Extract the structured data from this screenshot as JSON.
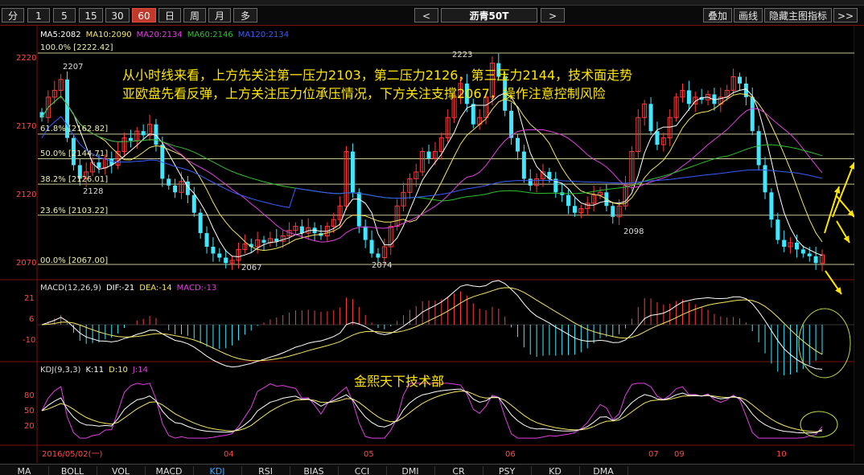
{
  "toolbar": {
    "periods": [
      "分",
      "1",
      "5",
      "15",
      "30",
      "60",
      "日",
      "周",
      "月",
      "多"
    ],
    "active_period": "60",
    "prev": "<",
    "instrument": "沥青50T",
    "next": ">",
    "overlay": "叠加",
    "draw": "画线",
    "hide_indicator": "隐藏主图指标",
    "more": ">>"
  },
  "main_panel": {
    "ma_legend": [
      {
        "text": "MA5:2082",
        "color": "#ffffff"
      },
      {
        "text": "MA10:2090",
        "color": "#f5e663"
      },
      {
        "text": "MA20:2134",
        "color": "#e040e0"
      },
      {
        "text": "MA60:2146",
        "color": "#2fbf2f"
      },
      {
        "text": "MA120:2134",
        "color": "#3a5cff"
      }
    ],
    "y_ticks": [
      "2220",
      "2170",
      "2120",
      "2070"
    ],
    "fib_levels": [
      {
        "label": "100.0% [2222.42]",
        "value": 2222.42
      },
      {
        "label": "61.8% [2162.82]",
        "value": 2162.82
      },
      {
        "label": "50.0% [2144.71]",
        "value": 2144.71
      },
      {
        "label": "38.2% [2126.01]",
        "value": 2126.01
      },
      {
        "label": "23.6% [2103.22]",
        "value": 2103.22
      },
      {
        "label": "00.0% [2067.00]",
        "value": 2067.0
      }
    ],
    "price_marks": [
      "2207",
      "2128",
      "2067",
      "2074",
      "2223",
      "2098"
    ],
    "annotation_line1": "从小时线来看，上方先关注第一压力2103，第二压力2126，第三压力2144，技术面走势",
    "annotation_line2": "亚欧盘先看反弹，上方关注压力位承压情况，下方关注支撑2067，操作注意控制风险"
  },
  "macd_panel": {
    "legend": [
      {
        "text": "MACD(12,26,9)",
        "color": "#dddddd"
      },
      {
        "text": "DIF:-21",
        "color": "#ffffff"
      },
      {
        "text": "DEA:-14",
        "color": "#f5e663"
      },
      {
        "text": "MACD:-13",
        "color": "#e040e0"
      }
    ],
    "y_ticks": [
      "21",
      "6",
      "-10"
    ]
  },
  "kdj_panel": {
    "legend": [
      {
        "text": "KDJ(9,3,3)",
        "color": "#dddddd"
      },
      {
        "text": "K:11",
        "color": "#ffffff"
      },
      {
        "text": "D:10",
        "color": "#f5e663"
      },
      {
        "text": "J:14",
        "color": "#e040e0"
      }
    ],
    "y_ticks": [
      "80",
      "50",
      "20"
    ],
    "watermark": "金熙天下技术部"
  },
  "time_axis": {
    "start_label": "2016/05/02(一)",
    "months": [
      "04",
      "05",
      "06",
      "07",
      "09",
      "10"
    ]
  },
  "bottom_tabs": [
    "MA",
    "BOLL",
    "VOL",
    "MACD",
    "KDJ",
    "RSI",
    "BIAS",
    "CCI",
    "DMI",
    "CR",
    "PSY",
    "KD",
    "DMA"
  ],
  "active_bottom_tab": "KDJ",
  "colors": {
    "up": "#ff3b3b",
    "down": "#3fe8ff",
    "grid": "#7a1212",
    "fib": "#e8e8b0",
    "arrow": "#ffe600",
    "annotation": "#ffe600"
  }
}
